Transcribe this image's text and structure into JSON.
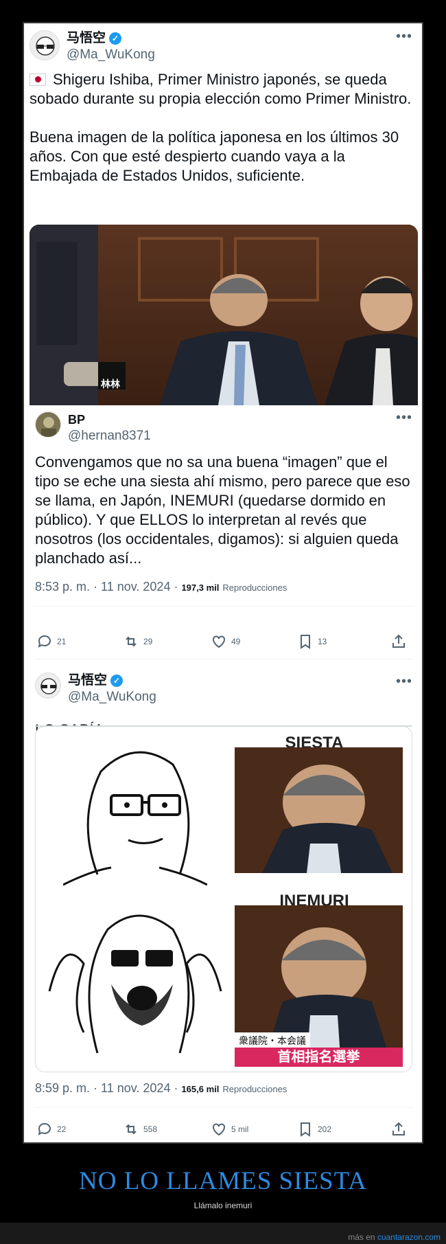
{
  "tweet1": {
    "display_name": "马悟空",
    "handle": "@Ma_WuKong",
    "flag_icon": "japan-flag-icon",
    "text": "Shigeru Ishiba, Primer Ministro japonés, se queda sobado durante su propia elección como Primer Ministro.\n\nBuena imagen de la política japonesa en los últimos 30 años. Con que esté despierto cuando vaya a la Embajada de Estados Unidos, suficiente.",
    "image_overlay": "林林"
  },
  "tweet2": {
    "display_name": "BP",
    "handle": "@hernan8371",
    "text": "Convengamos que no sa una buena “imagen” que el tipo se eche una siesta ahí mismo, pero parece que eso se llama, en Japón, INEMURI (quedarse dormido en público). Y que ELLOS lo interpretan al revés que nosotros (los occidentales, digamos): si alguien queda planchado así...",
    "time": "8:53 p. m. · 11 nov. 2024 · ",
    "views": "197,3 mil",
    "views_label": "Reproducciones",
    "replies": "21",
    "retweets": "29",
    "likes": "49",
    "bookmarks": "13"
  },
  "tweet3": {
    "display_name": "马悟空",
    "handle": "@Ma_WuKong",
    "text": "LO SABÍA",
    "meme_top_label": "SIESTA",
    "meme_bottom_label": "INEMURI",
    "caption_line1": "衆議院・本会議",
    "caption_line2": "首相指名選挙",
    "time": "8:59 p. m. · 11 nov. 2024 · ",
    "views": "165,6 mil",
    "views_label": "Reproducciones",
    "replies": "22",
    "retweets": "558",
    "likes": "5 mil",
    "bookmarks": "202"
  },
  "footer": {
    "title": "NO LO LLAMES SIESTA",
    "subtitle": "Llámalo inemuri",
    "credit_prefix": "más en ",
    "credit_link": "cuantarazon.com"
  },
  "colors": {
    "link": "#2d8ae0",
    "verified": "#1d9bf0",
    "caption_bar": "#d9275f"
  }
}
